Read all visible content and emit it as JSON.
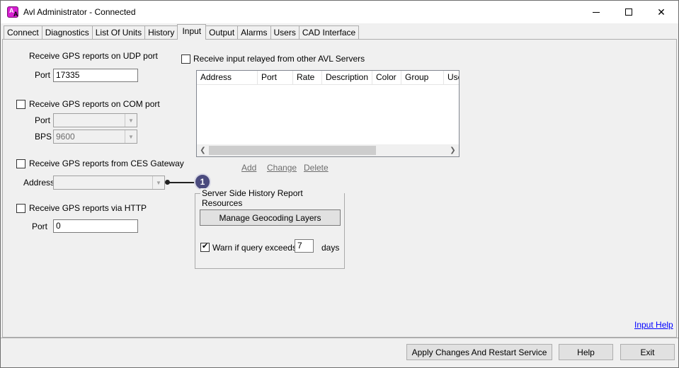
{
  "window": {
    "title": "Avl Administrator - Connected",
    "app_icon": "avl-icon"
  },
  "tabs": [
    {
      "label": "Connect",
      "active": false
    },
    {
      "label": "Diagnostics",
      "active": false
    },
    {
      "label": "List Of Units",
      "active": false
    },
    {
      "label": "History",
      "active": false
    },
    {
      "label": "Input",
      "active": true
    },
    {
      "label": "Output",
      "active": false
    },
    {
      "label": "Alarms",
      "active": false
    },
    {
      "label": "Users",
      "active": false
    },
    {
      "label": "CAD Interface",
      "active": false
    }
  ],
  "udp": {
    "heading": "Receive GPS reports on UDP port",
    "port_label": "Port",
    "port_value": "17335"
  },
  "com": {
    "checkbox_label": "Receive GPS reports on COM port",
    "checked": false,
    "port_label": "Port",
    "port_value": "",
    "bps_label": "BPS",
    "bps_value": "9600"
  },
  "ces": {
    "checkbox_label": "Receive GPS reports from CES Gateway",
    "checked": false,
    "address_label": "Address",
    "address_value": ""
  },
  "http": {
    "checkbox_label": "Receive GPS reports via HTTP",
    "checked": false,
    "port_label": "Port",
    "port_value": "0"
  },
  "relay": {
    "checkbox_label": "Receive input relayed from other AVL Servers",
    "checked": false,
    "columns": [
      "Address",
      "Port",
      "Rate",
      "Description",
      "Color",
      "Group",
      "Use"
    ],
    "rows": [],
    "add_label": "Add",
    "change_label": "Change",
    "delete_label": "Delete"
  },
  "callout": {
    "number": "1"
  },
  "history_group": {
    "title": "Server Side History Report Resources",
    "manage_button": "Manage Geocoding Layers",
    "warn_label": "Warn if query exceeds",
    "warn_checked": true,
    "warn_value": "7",
    "days_label": "days"
  },
  "footer": {
    "help_link": "Input Help",
    "apply_button": "Apply Changes And Restart Service",
    "help_button": "Help",
    "exit_button": "Exit"
  }
}
